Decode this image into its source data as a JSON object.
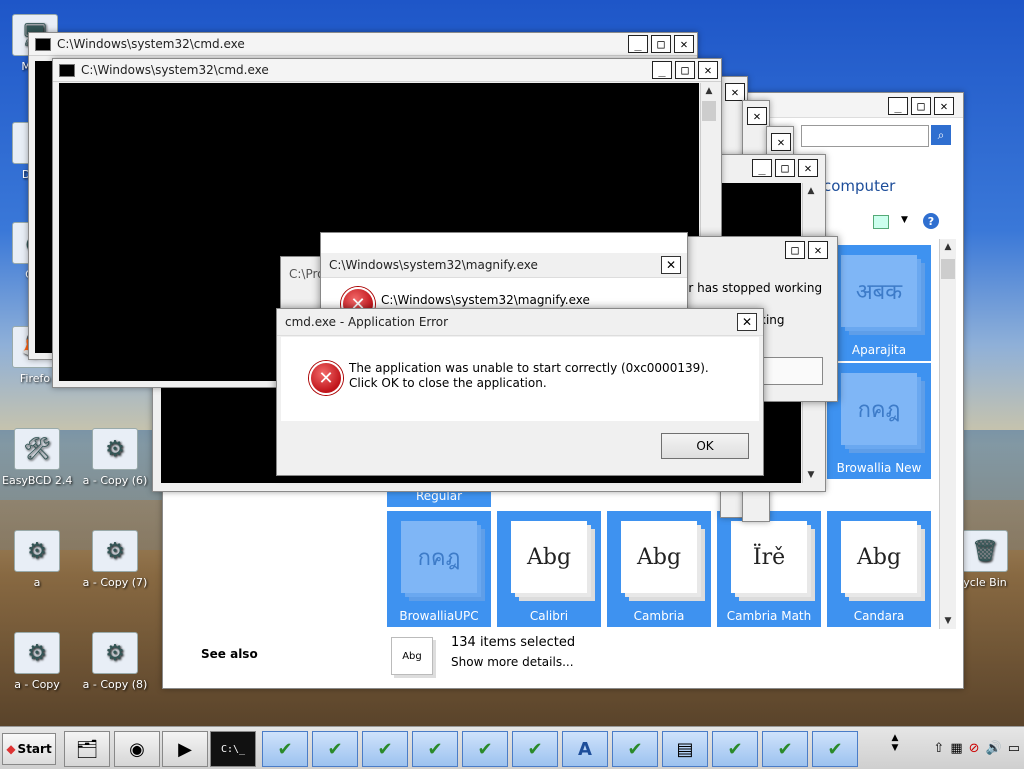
{
  "desktop": {
    "icons": [
      {
        "label": "My C",
        "glyph": "🖥"
      },
      {
        "label": "Data",
        "glyph": "↗"
      },
      {
        "label": "G C",
        "glyph": "●"
      },
      {
        "label": "Firefo",
        "glyph": "🦊"
      },
      {
        "label": "EasyBCD 2.4",
        "glyph": "🛠"
      },
      {
        "label": "a - Copy (6)",
        "glyph": "⚙"
      },
      {
        "label": "a",
        "glyph": "⚙"
      },
      {
        "label": "a - Copy (7)",
        "glyph": "⚙"
      },
      {
        "label": "a - Copy",
        "glyph": "⚙"
      },
      {
        "label": "a - Copy (8)",
        "glyph": "⚙"
      },
      {
        "label": "ycle Bin",
        "glyph": "🗑"
      }
    ]
  },
  "cmd_windows": [
    {
      "title": "C:\\Windows\\system32\\cmd.exe"
    },
    {
      "title": "C:\\Windows\\system32\\cmd.exe"
    }
  ],
  "explorer": {
    "heading": "computer",
    "see_also": "See also",
    "status_count": "134 items selected",
    "status_more": "Show more details...",
    "status_thumb": "Abg",
    "fonts": [
      {
        "name": "Aparajita",
        "sample": "अबक",
        "pale": true
      },
      {
        "name": "Browallia New",
        "sample": "กคฎ",
        "pale": true
      },
      {
        "name": "BrowalliaUPC",
        "sample": "กคฎ",
        "pale": true
      },
      {
        "name": "Calibri",
        "sample": "Abg",
        "pale": false
      },
      {
        "name": "Cambria",
        "sample": "Abg",
        "pale": false
      },
      {
        "name": "Cambria Math",
        "sample": "Ïrě",
        "pale": false
      },
      {
        "name": "Candara",
        "sample": "Abg",
        "pale": false
      },
      {
        "name": "Regular",
        "sample": "",
        "pale": false
      }
    ]
  },
  "stopped_dialog": {
    "line1": "or has stopped working",
    "line2": "king"
  },
  "prog_dialog": {
    "title": "C:\\Pro"
  },
  "magnify_dialog": {
    "title": "C:\\Windows\\system32\\magnify.exe",
    "message": "C:\\Windows\\system32\\magnify.exe"
  },
  "error_dialog": {
    "title": "cmd.exe - Application Error",
    "message": "The application was unable to start correctly (0xc0000139). Click OK to close the application.",
    "ok_label": "OK",
    "close_label": "✕"
  },
  "taskbar": {
    "start_label": "Start",
    "items": [
      "🗂",
      "◉",
      "▶",
      "C:\\_",
      "✔",
      "✔",
      "✔",
      "✔",
      "✔",
      "✔",
      "A",
      "✔",
      "▤",
      "✔",
      "✔",
      "✔"
    ],
    "tray": [
      "⇧",
      "▦",
      "⊘",
      "🔊",
      "▭"
    ]
  },
  "colors": {
    "tile_blue": "#3e92f0",
    "link_blue": "#1e4e9a"
  }
}
